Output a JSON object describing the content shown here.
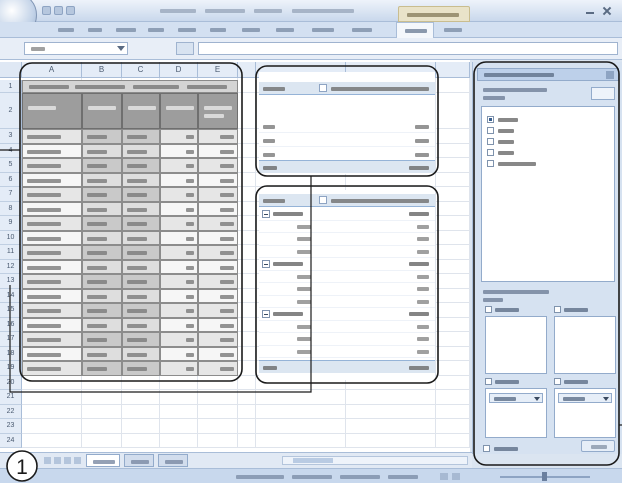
{
  "sheet": {
    "column_letters": [
      "A",
      "B",
      "C",
      "D",
      "E"
    ],
    "row_numbers": [
      "1",
      "2",
      "3",
      "4",
      "5",
      "6",
      "7",
      "8",
      "9",
      "10",
      "11",
      "12",
      "13",
      "14",
      "15",
      "16",
      "17",
      "18",
      "19",
      "20",
      "21",
      "22",
      "23",
      "24"
    ]
  },
  "marker": {
    "label": "1"
  },
  "colors": {
    "window_frame": "#dbe5f1",
    "annotation_stroke": "#1a1a1a",
    "table_header_fill": "#9d9d9d",
    "pivot_header_fill": "#dce6f1"
  }
}
